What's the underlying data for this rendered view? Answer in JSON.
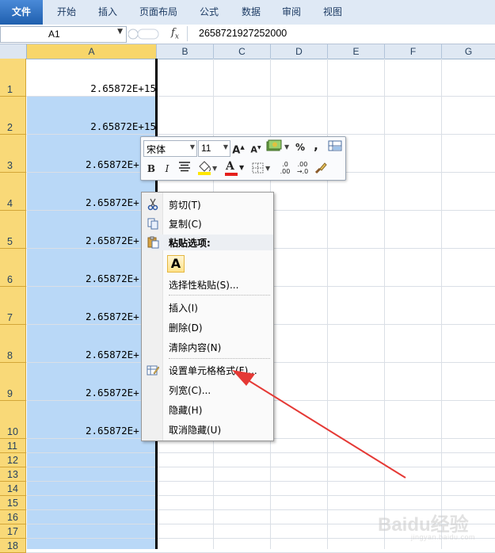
{
  "ribbon": {
    "tabs": [
      {
        "label": "文件"
      },
      {
        "label": "开始"
      },
      {
        "label": "插入"
      },
      {
        "label": "页面布局"
      },
      {
        "label": "公式"
      },
      {
        "label": "数据"
      },
      {
        "label": "审阅"
      },
      {
        "label": "视图"
      }
    ]
  },
  "formula_bar": {
    "name_box": "A1",
    "fx": "fx",
    "value": "2658721927252000"
  },
  "grid": {
    "columns": [
      "A",
      "B",
      "C",
      "D",
      "E",
      "F",
      "G"
    ],
    "rows": [
      "1",
      "2",
      "3",
      "4",
      "5",
      "6",
      "7",
      "8",
      "9",
      "10",
      "11",
      "12",
      "13",
      "14",
      "15",
      "16",
      "17",
      "18"
    ],
    "column_a_values": [
      "2.65872E+15",
      "2.65872E+15",
      "2.65872E+",
      "2.65872E+",
      "2.65872E+",
      "2.65872E+",
      "2.65872E+",
      "2.65872E+",
      "2.65872E+",
      "2.65872E+"
    ],
    "selection_color": "#b9d8f7",
    "row_header_color": "#f9d978"
  },
  "mini_toolbar": {
    "font_name": "宋体",
    "font_size": "11",
    "grow_font": "A",
    "shrink_font": "A",
    "percent": "%",
    "comma": ",",
    "bold": "B",
    "italic": "I",
    "font_color": "A",
    "inc_decimal": "←.0\n.00",
    "inc_decimal_top": ".0",
    "inc_decimal_bot": ".00",
    "dec_decimal_top": ".00",
    "dec_decimal_bot": "→.0"
  },
  "context_menu": {
    "items": [
      {
        "label": "剪切(T)",
        "icon": "scissors-icon"
      },
      {
        "label": "复制(C)",
        "icon": "copy-icon"
      },
      {
        "label": "粘贴选项:",
        "icon": "paste-icon"
      },
      {
        "label": "A",
        "icon": ""
      },
      {
        "label": "选择性粘贴(S)...",
        "icon": ""
      },
      {
        "label": "插入(I)",
        "icon": ""
      },
      {
        "label": "删除(D)",
        "icon": ""
      },
      {
        "label": "清除内容(N)",
        "icon": ""
      },
      {
        "label": "设置单元格格式(F)...",
        "icon": "format-cells-icon"
      },
      {
        "label": "列宽(C)...",
        "icon": ""
      },
      {
        "label": "隐藏(H)",
        "icon": ""
      },
      {
        "label": "取消隐藏(U)",
        "icon": ""
      }
    ]
  },
  "annotation": {
    "arrow_color": "#e53935"
  },
  "watermark": {
    "text": "Baidu经验",
    "sub": "jingyan.baidu.com"
  }
}
